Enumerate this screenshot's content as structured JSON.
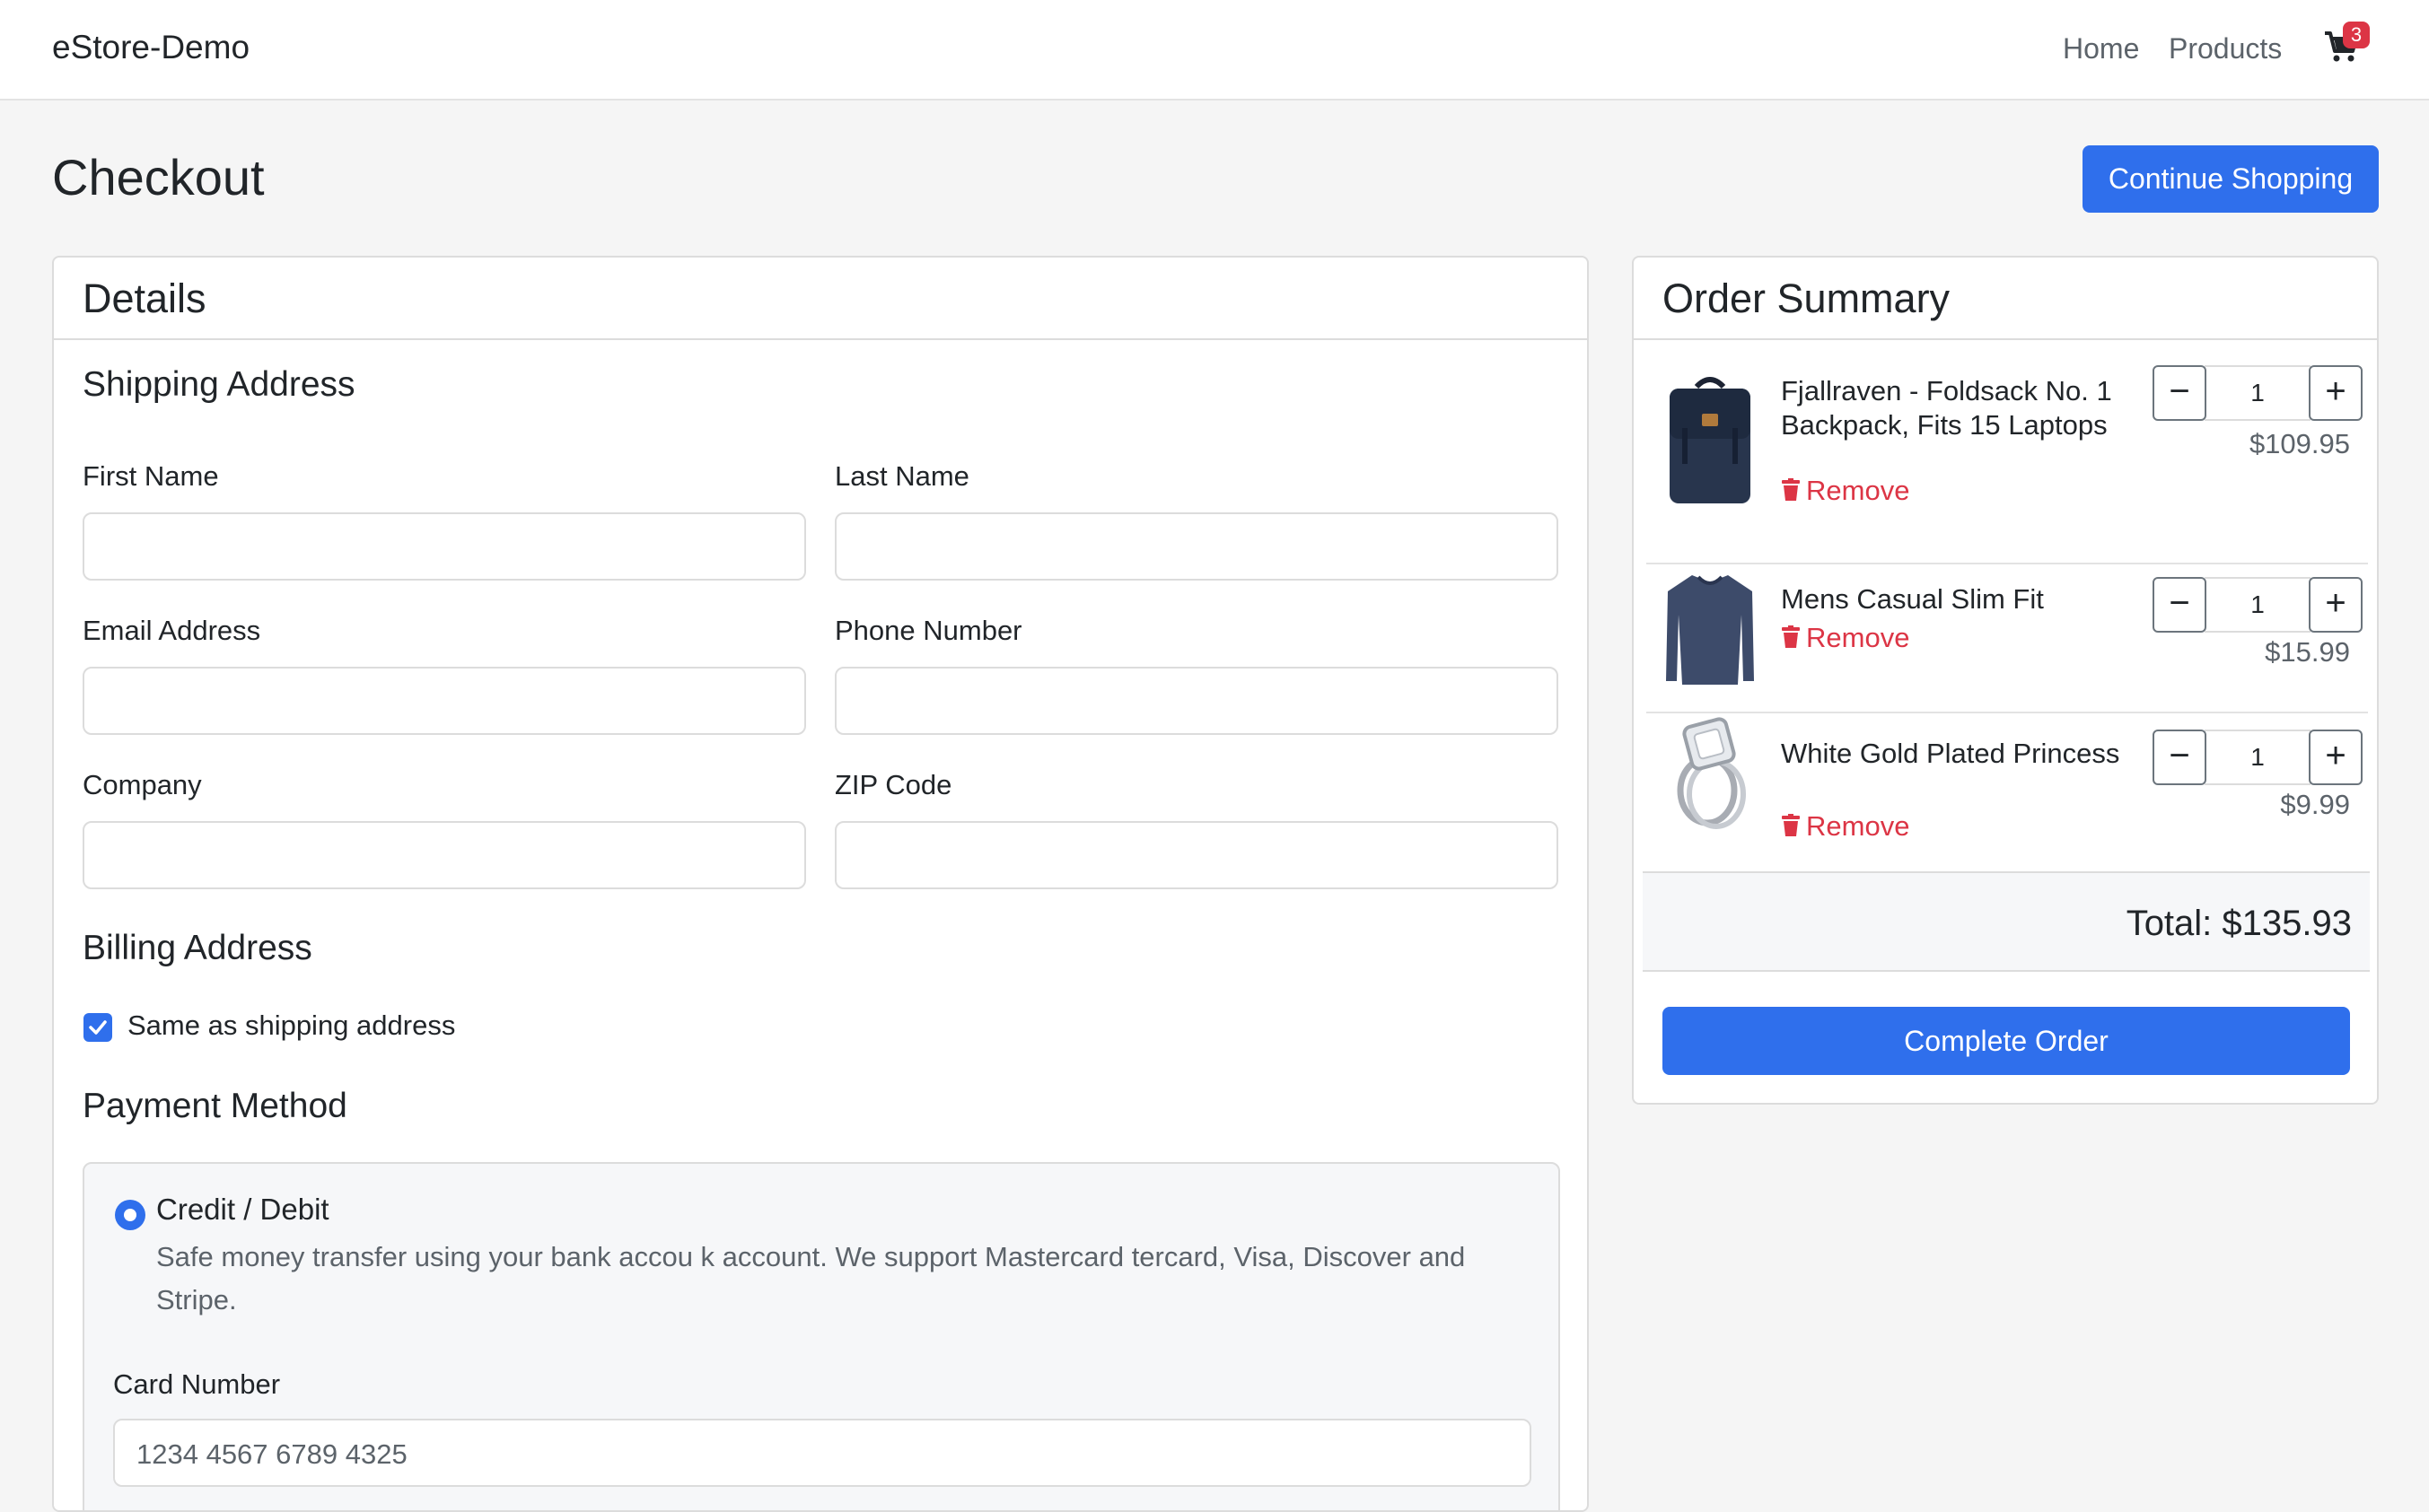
{
  "navbar": {
    "brand": "eStore-Demo",
    "links": [
      "Home",
      "Products"
    ],
    "cart_count": "3"
  },
  "header": {
    "title": "Checkout",
    "continue_label": "Continue Shopping"
  },
  "details": {
    "title": "Details",
    "shipping_title": "Shipping Address",
    "fields": {
      "first_name": "First Name",
      "last_name": "Last Name",
      "email": "Email Address",
      "phone": "Phone Number",
      "company": "Company",
      "zip": "ZIP Code"
    },
    "billing_title": "Billing Address",
    "same_as_shipping_label": "Same as shipping address",
    "same_as_shipping_checked": true,
    "payment_title": "Payment Method",
    "payment": {
      "method": "Credit / Debit",
      "description": "Safe money transfer using your bank accou k account. We support Mastercard tercard, Visa, Discover and Stripe.",
      "card_number_label": "Card Number",
      "card_number_value": "1234 4567 6789 4325"
    }
  },
  "summary": {
    "title": "Order Summary",
    "remove_label": "Remove",
    "items": [
      {
        "name": "Fjallraven - Foldsack No. 1 Backpack, Fits 15 Laptops",
        "qty": "1",
        "price": "$109.95",
        "image": "backpack"
      },
      {
        "name": "Mens Casual Slim Fit",
        "qty": "1",
        "price": "$15.99",
        "image": "shirt"
      },
      {
        "name": "White Gold Plated Princess",
        "qty": "1",
        "price": "$9.99",
        "image": "ring"
      }
    ],
    "total": "Total: $135.93",
    "complete_label": "Complete Order"
  },
  "colors": {
    "primary": "#2f6fec",
    "danger": "#dc3545",
    "background": "#f5f5f5"
  }
}
